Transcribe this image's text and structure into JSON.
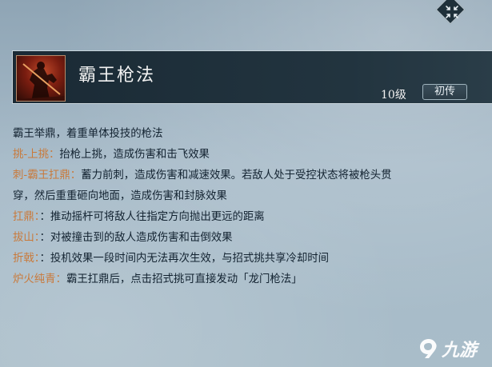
{
  "skill": {
    "name": "霸王枪法",
    "level": "10级",
    "tier": "初传",
    "summary": "霸王举鼎，着重单体投技的枪法"
  },
  "moves": [
    {
      "name": "挑-上挑：",
      "desc": "抬枪上挑，造成伤害和击飞效果"
    },
    {
      "name": "刺-霸王扛鼎：",
      "desc": "蓄力前刺，造成伤害和减速效果。若敌人处于受控状态将被枪头贯",
      "desc_cont": "穿，然后重重砸向地面，造成伤害和封脉效果"
    },
    {
      "name": "扛鼎：",
      "desc": "：推动摇杆可将敌人往指定方向抛出更远的距离"
    },
    {
      "name": "拔山：",
      "desc": "：对被撞击到的敌人造成伤害和击倒效果"
    },
    {
      "name": "折戟：",
      "desc": "：投机效果一段时间内无法再次生效，与招式挑共享冷却时间"
    },
    {
      "name": "炉火纯青：",
      "desc": "霸王扛鼎后，点击招式挑可直接发动「龙门枪法」"
    }
  ],
  "watermark": {
    "text": "九游"
  },
  "icons": {
    "collapse": "collapse-arrows-icon",
    "portrait": "skill-portrait",
    "watermark_logo": "jiuyou-logo-icon"
  },
  "colors": {
    "keyword": "#c9793a",
    "body_text": "#122230",
    "header_bg": "#1a2a35"
  }
}
